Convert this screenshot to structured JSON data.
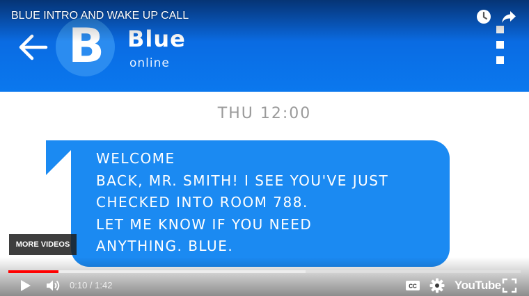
{
  "video": {
    "title": "BLUE INTRO AND WAKE UP CALL"
  },
  "chat": {
    "contact_initial": "B",
    "contact_name": "Blue",
    "contact_status": "online",
    "timestamp": "THU 12:00",
    "message_lines": [
      "WELCOME",
      "BACK, MR. SMITH! I SEE YOU'VE JUST",
      "CHECKED INTO ROOM 788.",
      "LET ME KNOW IF YOU NEED",
      "ANYTHING. BLUE."
    ],
    "header_color": "#0a6fe6",
    "bubble_color": "#1b8af2"
  },
  "player": {
    "more_videos_label": "MORE VIDEOS",
    "time_display": "0:10 / 1:42",
    "played_fraction": 0.098,
    "buffered_fraction": 0.58,
    "brand_label": "YouTube",
    "progress_color": "#ff0000",
    "icons": [
      "watch-later-icon",
      "share-icon",
      "play-icon",
      "volume-icon",
      "captions-icon",
      "settings-icon",
      "fullscreen-icon"
    ]
  }
}
